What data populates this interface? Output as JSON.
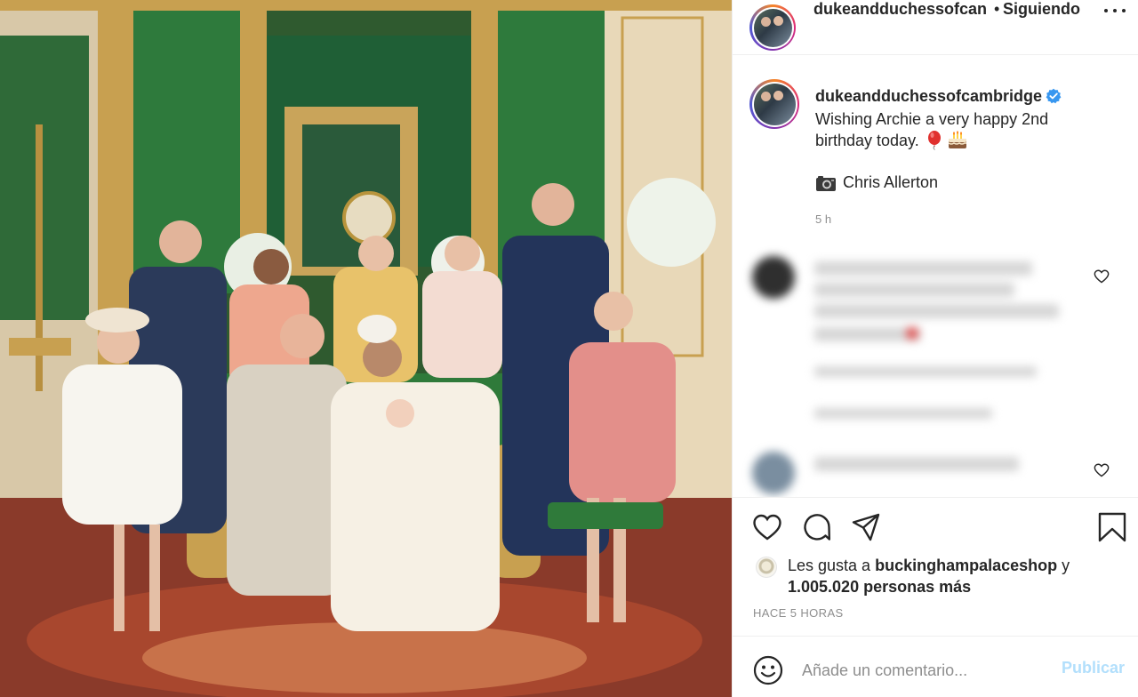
{
  "header": {
    "username": "dukeandduchessofcan",
    "separator": "•",
    "follow_status": "Siguiendo"
  },
  "caption": {
    "username": "dukeandduchessofcambridge",
    "text_line1": "Wishing Archie a very happy 2nd",
    "text_line2": "birthday today.",
    "emojis": [
      "balloon",
      "birthday-cake"
    ],
    "credit": "Chris Allerton",
    "time": "5 h"
  },
  "comments_blurred": true,
  "actions": {
    "icons": [
      "heart-icon",
      "comment-icon",
      "share-icon",
      "bookmark-icon"
    ],
    "likes_prefix": "Les gusta a",
    "likes_user": "buckinghampalaceshop",
    "likes_and": "y",
    "likes_count": "1.005.020 personas más",
    "date": "HACE 5 HORAS"
  },
  "add_comment": {
    "placeholder": "Añade un comentario...",
    "publish_label": "Publicar"
  },
  "colors": {
    "verified": "#3897f0",
    "publish_disabled": "#b2dffc",
    "secondary_text": "#8e8e8e"
  }
}
